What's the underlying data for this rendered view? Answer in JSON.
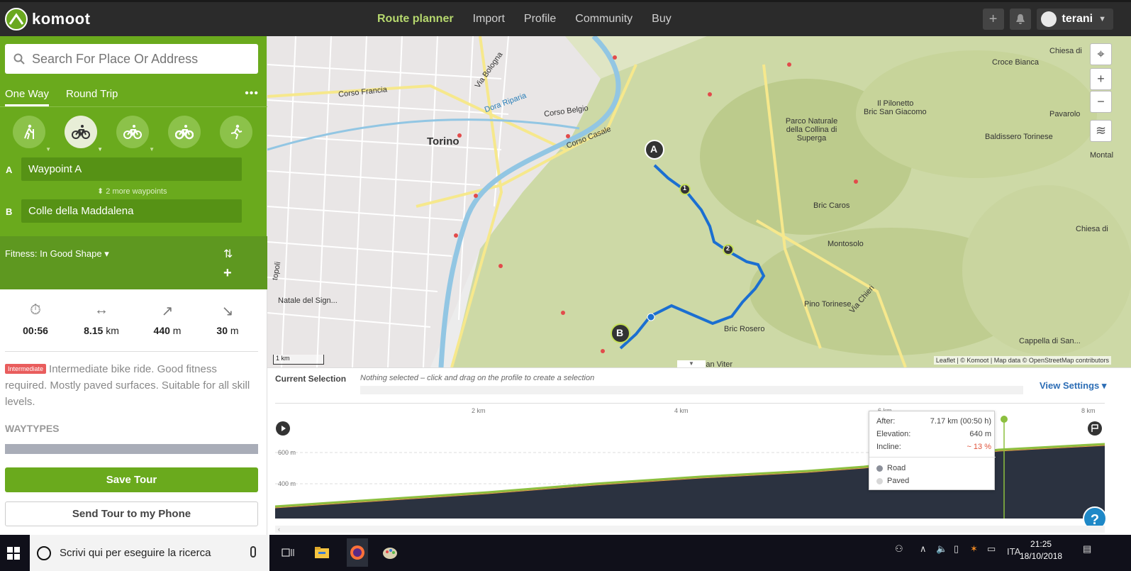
{
  "app": {
    "brand": "komoot"
  },
  "nav": {
    "items": [
      "Route planner",
      "Import",
      "Profile",
      "Community",
      "Buy"
    ],
    "active": "Route planner",
    "add_icon": "plus-square-icon",
    "bell_icon": "bell-icon",
    "username": "terani"
  },
  "planner": {
    "search_placeholder": "Search For Place Or Address",
    "tabs": {
      "one_way": "One Way",
      "round_trip": "Round Trip"
    },
    "sports": [
      "hiking-icon",
      "road-bike-icon",
      "touring-bike-icon",
      "mountain-bike-icon",
      "running-icon"
    ],
    "waypoint_a_label": "A",
    "waypoint_a": "Waypoint A",
    "more_waypoints": "2 more waypoints",
    "waypoint_b_label": "B",
    "waypoint_b": "Colle della Maddalena",
    "fitness": "Fitness: In Good Shape",
    "stats": [
      {
        "icon": "stopwatch-icon",
        "value": "00:56",
        "unit": ""
      },
      {
        "icon": "distance-icon",
        "value": "8.15",
        "unit": "km"
      },
      {
        "icon": "uphill-icon",
        "value": "440",
        "unit": "m"
      },
      {
        "icon": "downhill-icon",
        "value": "30",
        "unit": "m"
      }
    ],
    "difficulty_badge": "Intermediate",
    "description": "Intermediate bike ride. Good fitness required. Mostly paved surfaces. Suitable for all skill levels.",
    "waytypes_heading": "WAYTYPES",
    "save_button": "Save Tour",
    "send_button": "Send Tour to my Phone"
  },
  "map": {
    "labels": {
      "torino": "Torino",
      "corso_francia": "Corso Francia",
      "corso_belgio": "Corso Belgio",
      "corso_casale": "Corso Casale",
      "via_bologna": "Via Bologna",
      "dora_riparia": "Dora Riparia",
      "parco": "Parco Naturale della Collina di Superga",
      "bric_san_giacomo": "Bric San Giacomo",
      "croce_bianca": "Croce Bianca",
      "il_pilonetto": "Il Pilonetto",
      "pavarolo": "Pavarolo",
      "baldissero": "Baldissero Torinese",
      "chiesa_di_top": "Chiesa di",
      "montal": "Montal",
      "bric_caros": "Bric Caros",
      "montosolo": "Montosolo",
      "chiesa_di_mid": "Chiesa di",
      "pino_torinese": "Pino Torinese",
      "bric_rosero": "Bric Rosero",
      "cappella": "Cappella di San...",
      "natale": "Natale del Sign...",
      "san_viter": "San Viter",
      "via_chieri": "Via Chieri",
      "topoli": "topoli"
    },
    "marker_a": "A",
    "marker_b": "B",
    "waypoint_1": "1",
    "waypoint_2": "2",
    "scale": "1 km",
    "attribution": "Leaflet | © Komoot | Map data © OpenStreetMap contributors",
    "route_color": "#1b6fd1"
  },
  "profile": {
    "current_selection_label": "Current Selection",
    "current_selection_text": "Nothing selected – click and drag on the profile to create a selection",
    "view_settings": "View Settings",
    "km_ticks": [
      "2 km",
      "4 km",
      "6 km",
      "8 km"
    ],
    "elev_ticks": [
      "600 m",
      "400 m"
    ],
    "tooltip": {
      "after_label": "After:",
      "after_value": "7.17 km (00:50 h)",
      "elevation_label": "Elevation:",
      "elevation_value": "640 m",
      "incline_label": "Incline:",
      "incline_value": "~ 13 %",
      "legend": [
        "Road",
        "Paved"
      ]
    },
    "help": "?"
  },
  "taskbar": {
    "search_text": "Scrivi qui per eseguire la ricerca",
    "lang": "ITA",
    "time": "21:25",
    "date": "18/10/2018"
  }
}
